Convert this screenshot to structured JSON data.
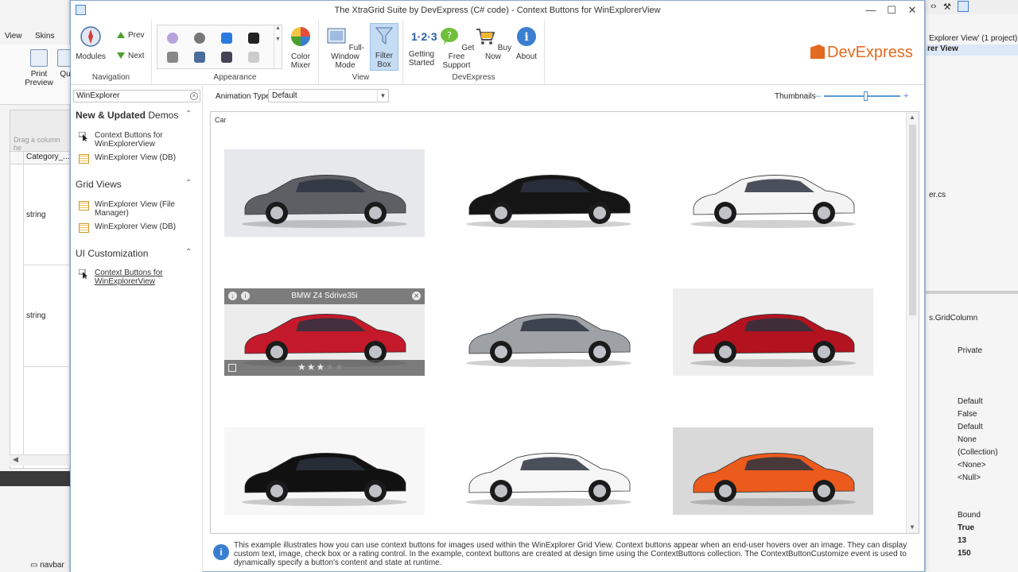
{
  "colors": {
    "accent": "#3b7fd1",
    "brand": "#e36a1f",
    "activeButton": "#c5dcf5",
    "overlay": "#505050"
  },
  "ide_left": {
    "menu": [
      "View",
      "Skins"
    ],
    "ribbon_buttons": [
      {
        "label": "Print Preview"
      },
      {
        "label": "Qu"
      }
    ],
    "grid_drag_text": "Drag a column he",
    "grid_header": "Category_...",
    "cells": [
      "string",
      "string"
    ],
    "taskbar_item": "navbar"
  },
  "ide_right": {
    "solution_text": "Explorer View' (1 project)",
    "selected_text": "rer View",
    "file_text": "er.cs",
    "class_text": "s.GridColumn",
    "prop_values": [
      "Private",
      "Default",
      "False",
      "Default",
      "None",
      "(Collection)",
      "<None>",
      "<Null>",
      "Bound",
      "True",
      "13",
      "150"
    ]
  },
  "window": {
    "title": "The XtraGrid Suite by DevExpress (C# code) - Context Buttons for WinExplorerView",
    "controls": {
      "minimize": "—",
      "maximize": "☐",
      "close": "✕"
    }
  },
  "ribbon": {
    "navigation": {
      "caption": "Navigation",
      "modules": "Modules",
      "prev": "Prev",
      "next": "Next"
    },
    "appearance": {
      "caption": "Appearance",
      "color_mixer": "Color Mixer"
    },
    "view": {
      "caption": "View",
      "full_window": "Full-Window Mode",
      "filter_box": "Filter Box"
    },
    "devexpress": {
      "caption": "DevExpress",
      "getting_started": "Getting Started",
      "get_support": "Get Free Support",
      "buy_now": "Buy Now",
      "about": "About"
    },
    "logo": "DevExpress"
  },
  "sidebar": {
    "search_value": "WinExplorer",
    "sections": [
      {
        "title_bold": "New & Updated",
        "title_rest": " Demos",
        "items": [
          {
            "label": "Context Buttons for WinExplorerView",
            "icon": "cursor-icon"
          },
          {
            "label": "WinExplorer View (DB)",
            "icon": "grid-icon"
          }
        ]
      },
      {
        "title_bold": "",
        "title_rest": "Grid Views",
        "items": [
          {
            "label": "WinExplorer View (File Manager)",
            "icon": "grid-icon"
          },
          {
            "label": "WinExplorer View (DB)",
            "icon": "grid-icon"
          }
        ]
      },
      {
        "title_bold": "",
        "title_rest": "UI Customization",
        "items": [
          {
            "label": "Context Buttons for WinExplorerView",
            "icon": "cursor-icon"
          }
        ]
      }
    ]
  },
  "content": {
    "animation_label": "Animation Type",
    "animation_value": "Default",
    "thumbnails_label": "Thumbnails",
    "thumbnail_zoom": 0.55,
    "group_title": "Car",
    "hovered_tile": {
      "caption": "BMW Z4 Sdrive35i",
      "rating": 3,
      "rating_max": 5
    },
    "cars": [
      {
        "color": "#5d5f64",
        "bg": "#e6e8ec"
      },
      {
        "color": "#151515",
        "bg": "#ffffff"
      },
      {
        "color": "#f4f4f4",
        "bg": "#ffffff"
      },
      {
        "color": "#c4192a",
        "bg": "#ececec"
      },
      {
        "color": "#9ea2a6",
        "bg": "#ffffff"
      },
      {
        "color": "#b3121f",
        "bg": "#eeeeee"
      },
      {
        "color": "#111111",
        "bg": "#f7f7f7"
      },
      {
        "color": "#f6f6f6",
        "bg": "#ffffff"
      },
      {
        "color": "#ec5a1c",
        "bg": "#d9d9d9"
      }
    ],
    "info_text": "This example illustrates how you can use context buttons for images used within the WinExplorer Grid View. Context buttons appear when an end-user hovers over an image. They can display custom text, image, check box or a rating control. In the example, context buttons are created at design time using the ContextButtons collection. The ContextButtonCustomize event is used to dynamically specify a button's content and state at runtime."
  }
}
